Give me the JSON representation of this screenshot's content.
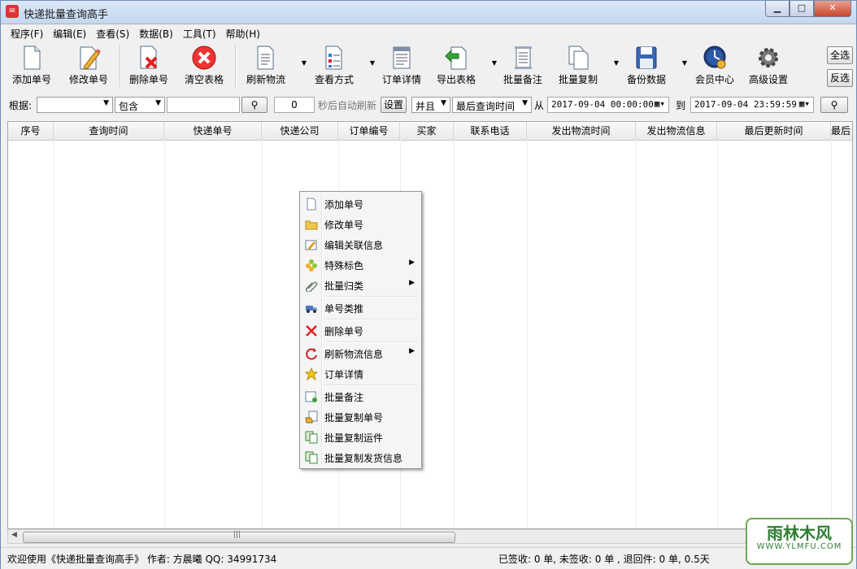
{
  "window": {
    "title": "快递批量查询高手",
    "app_icon": "app-logo-icon",
    "controls": [
      "minimize-icon",
      "maximize-icon",
      "close-icon"
    ]
  },
  "menubar": [
    "程序(F)",
    "编辑(E)",
    "查看(S)",
    "数据(B)",
    "工具(T)",
    "帮助(H)"
  ],
  "toolbar": {
    "add": "添加单号",
    "edit": "修改单号",
    "delete": "删除单号",
    "clear": "清空表格",
    "refresh": "刷新物流",
    "view": "查看方式",
    "detail": "订单详情",
    "export": "导出表格",
    "note": "批量备注",
    "copy": "批量复制",
    "backup": "备份数据",
    "member": "会员中心",
    "settings": "高级设置",
    "select_all": "全选",
    "invert": "反选"
  },
  "filter": {
    "label": "根据:",
    "field_value": "",
    "match_value": "包含",
    "keyword": "",
    "seconds": "0",
    "auto_refresh_label": "秒后自动刷新",
    "set_button": "设置",
    "logic_value": "并且",
    "time_field_value": "最后查询时间",
    "from_label": "从",
    "from_value": "2017-09-04 00:00:00",
    "to_label": "到",
    "to_value": "2017-09-04 23:59:59"
  },
  "grid": {
    "columns": [
      "序号",
      "查询时间",
      "快递单号",
      "快递公司",
      "订单编号",
      "买家",
      "联系电话",
      "发出物流时间",
      "发出物流信息",
      "最后更新时间",
      "最后"
    ]
  },
  "context_menu": {
    "items": [
      {
        "label": "添加单号",
        "icon": "blank-page-icon",
        "submenu": false
      },
      {
        "label": "修改单号",
        "icon": "folder-icon",
        "submenu": false
      },
      {
        "label": "编辑关联信息",
        "icon": "edit-form-icon",
        "submenu": false
      },
      {
        "label": "特殊标色",
        "icon": "color-flower-icon",
        "submenu": true
      },
      {
        "label": "批量归类",
        "icon": "paperclip-icon",
        "submenu": true
      },
      {
        "label": "单号类推",
        "icon": "truck-icon",
        "submenu": false
      },
      {
        "label": "删除单号",
        "icon": "red-x-icon",
        "submenu": false
      },
      {
        "label": "刷新物流信息",
        "icon": "refresh-icon",
        "submenu": true
      },
      {
        "label": "订单详情",
        "icon": "star-icon",
        "submenu": false
      },
      {
        "label": "批量备注",
        "icon": "note-icon",
        "submenu": false
      },
      {
        "label": "批量复制单号",
        "icon": "copy-hand-icon",
        "submenu": false
      },
      {
        "label": "批量复制运件",
        "icon": "copy-green-icon",
        "submenu": false
      },
      {
        "label": "批量复制发货信息",
        "icon": "copy-green-icon",
        "submenu": false
      }
    ]
  },
  "statusbar": {
    "welcome": "欢迎使用《快递批量查询高手》 作者: 方晨曦  QQ: 34991734",
    "counts": "已签收:  0 单, 未签收:  0 单 , 退回件:  0 单,  0.5天"
  },
  "watermark": {
    "title": "雨林木风",
    "url": "WWW.YLMFU.COM"
  },
  "colors": {
    "titlebar": "#c3d7ee",
    "close_button": "#c9452b",
    "grid_bg": "#ffffff"
  }
}
